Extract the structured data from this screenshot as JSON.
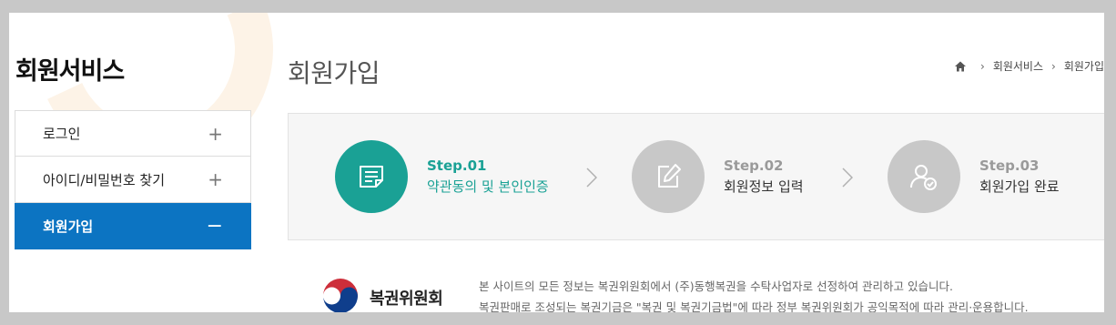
{
  "sidebar": {
    "title": "회원서비스",
    "items": [
      {
        "label": "로그인",
        "sign": "+"
      },
      {
        "label": "아이디/비밀번호 찾기",
        "sign": "+"
      },
      {
        "label": "회원가입",
        "sign": "−"
      }
    ]
  },
  "main": {
    "title": "회원가입",
    "breadcrumb": [
      "회원서비스",
      "회원가입"
    ],
    "steps": [
      {
        "num": "Step.01",
        "label": "약관동의 및 본인인증"
      },
      {
        "num": "Step.02",
        "label": "회원정보 입력"
      },
      {
        "num": "Step.03",
        "label": "회원가입 완료"
      }
    ]
  },
  "footer": {
    "org": "복권위원회",
    "lines": [
      "본 사이트의 모든 정보는 복권위원회에서 (주)동행복권을 수탁사업자로 선정하여 관리하고 있습니다.",
      "복권판매로 조성되는 복권기금은 \"복권 및 복권기금법\"에 따라 정부 복권위원회가 공익목적에 따라 관리·운용합니다."
    ]
  },
  "colors": {
    "accent": "#0c74c2",
    "step_active": "#1aa195",
    "step_inactive": "#c8c8c8"
  }
}
